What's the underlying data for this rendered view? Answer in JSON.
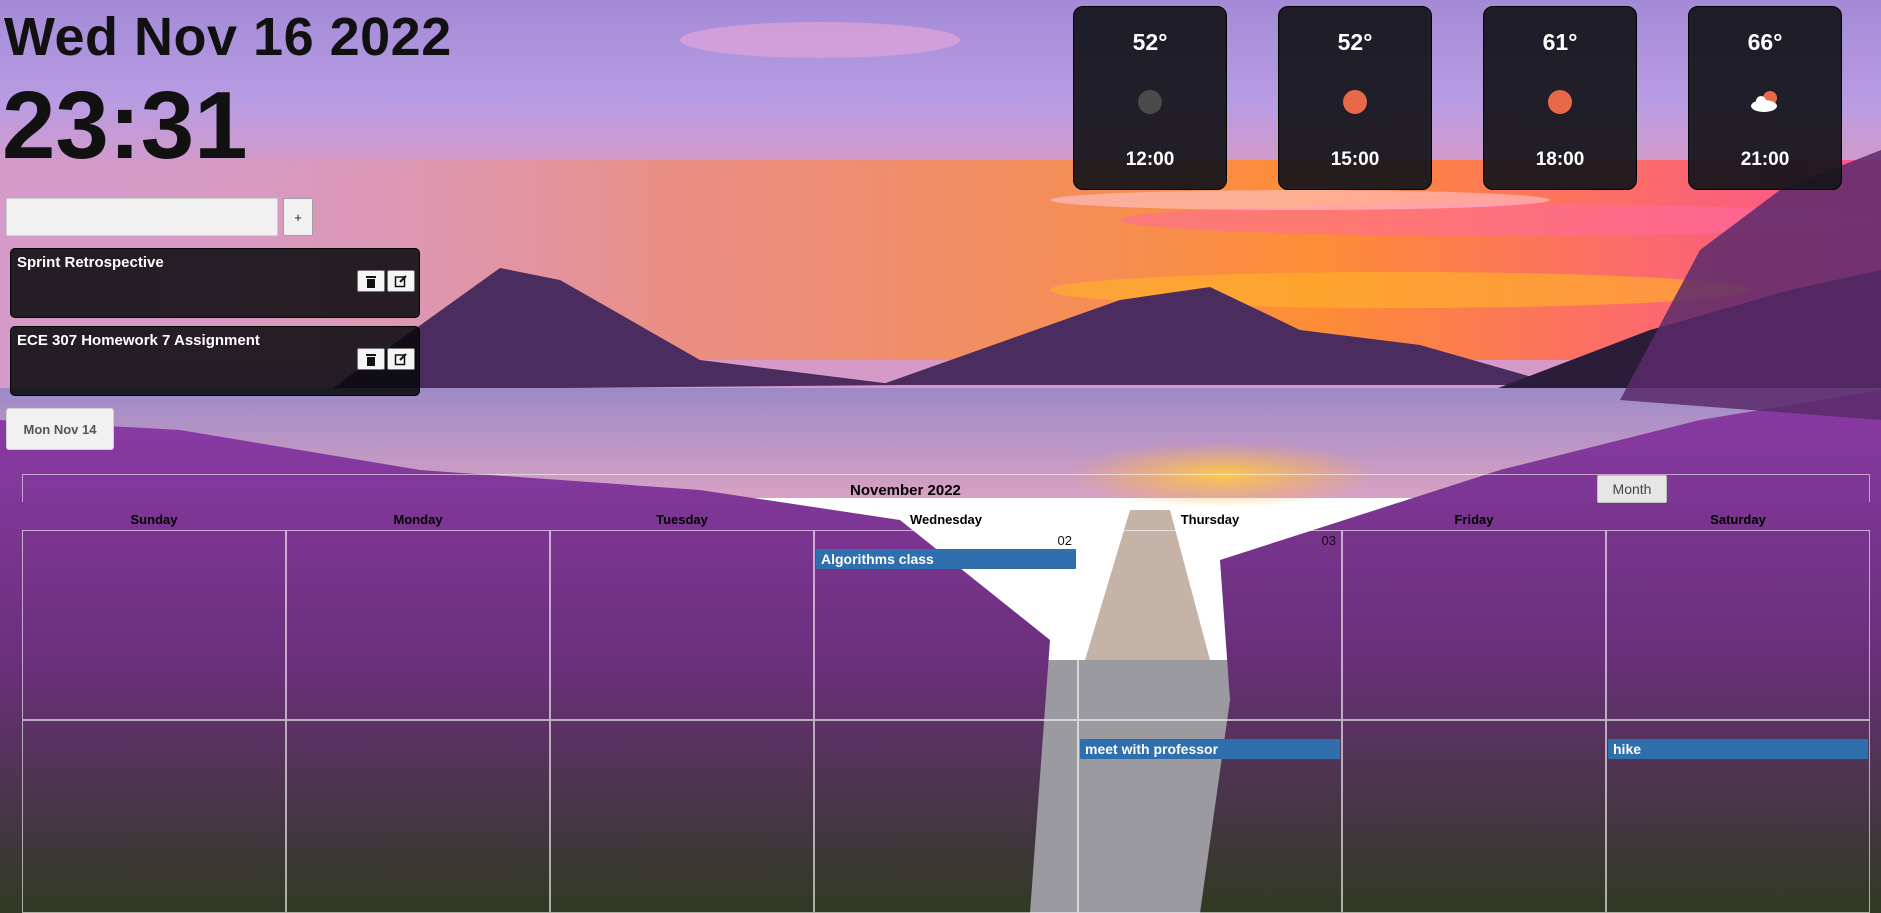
{
  "clock": {
    "date": "Wed Nov 16 2022",
    "time": "23:31"
  },
  "todo": {
    "input_placeholder": "",
    "add_label": "+",
    "items": [
      {
        "title": "Sprint Retrospective"
      },
      {
        "title": "ECE 307 Homework 7 Assignment"
      }
    ],
    "date_button": "Mon Nov 14"
  },
  "weather": [
    {
      "temp": "52°",
      "time": "12:00",
      "icon": "moon-icon",
      "color": "#4a4a4a"
    },
    {
      "temp": "52°",
      "time": "15:00",
      "icon": "sun-icon",
      "color": "#e8684a"
    },
    {
      "temp": "61°",
      "time": "18:00",
      "icon": "sun-icon",
      "color": "#e8684a"
    },
    {
      "temp": "66°",
      "time": "21:00",
      "icon": "partly-cloudy-icon",
      "color": "#e8684a"
    }
  ],
  "calendar": {
    "title": "November 2022",
    "view_button": "Month",
    "weekdays": [
      "Sunday",
      "Monday",
      "Tuesday",
      "Wednesday",
      "Thursday",
      "Friday",
      "Saturday"
    ],
    "first_row_numbers": [
      "",
      "",
      "",
      "02",
      "03",
      "",
      ""
    ],
    "events": [
      {
        "label": "Algorithms class"
      },
      {
        "label": "meet with professor"
      },
      {
        "label": "hike"
      }
    ]
  }
}
